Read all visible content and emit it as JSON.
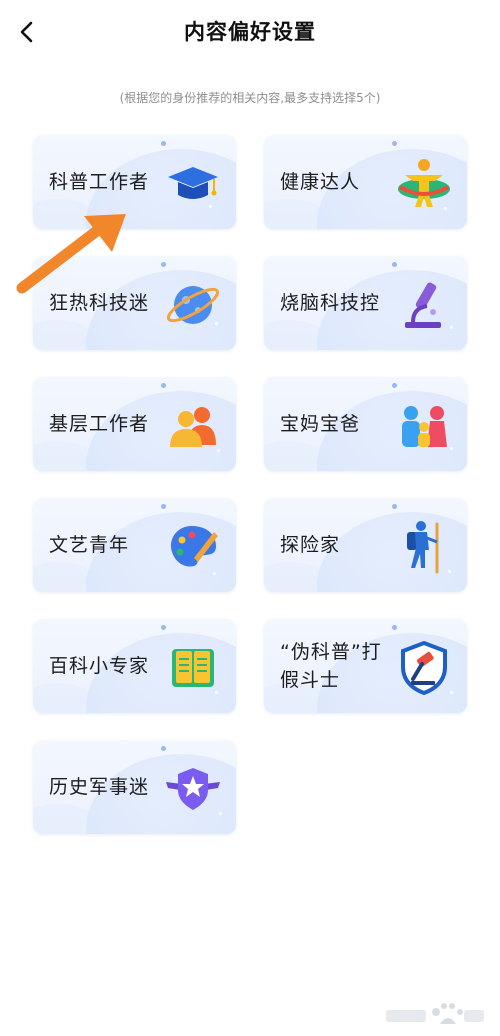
{
  "header": {
    "title": "内容偏好设置"
  },
  "subtitle": "(根据您的身份推荐的相关内容,最多支持选择5个)",
  "cards": [
    {
      "label": "科普工作者",
      "icon": "graduation-cap-icon"
    },
    {
      "label": "健康达人",
      "icon": "fitness-person-icon"
    },
    {
      "label": "狂热科技迷",
      "icon": "planet-icon"
    },
    {
      "label": "烧脑科技控",
      "icon": "microscope-icon"
    },
    {
      "label": "基层工作者",
      "icon": "people-group-icon"
    },
    {
      "label": "宝妈宝爸",
      "icon": "family-icon"
    },
    {
      "label": "文艺青年",
      "icon": "palette-icon"
    },
    {
      "label": "探险家",
      "icon": "hiker-icon"
    },
    {
      "label": "百科小专家",
      "icon": "book-icon"
    },
    {
      "label": "“伪科普”打假斗士",
      "icon": "shield-gavel-icon"
    },
    {
      "label": "历史军事迷",
      "icon": "military-star-icon"
    }
  ],
  "colors": {
    "card_bg": "#eef3fd",
    "accent_blue": "#2d6df6",
    "arrow": "#f2862b"
  }
}
